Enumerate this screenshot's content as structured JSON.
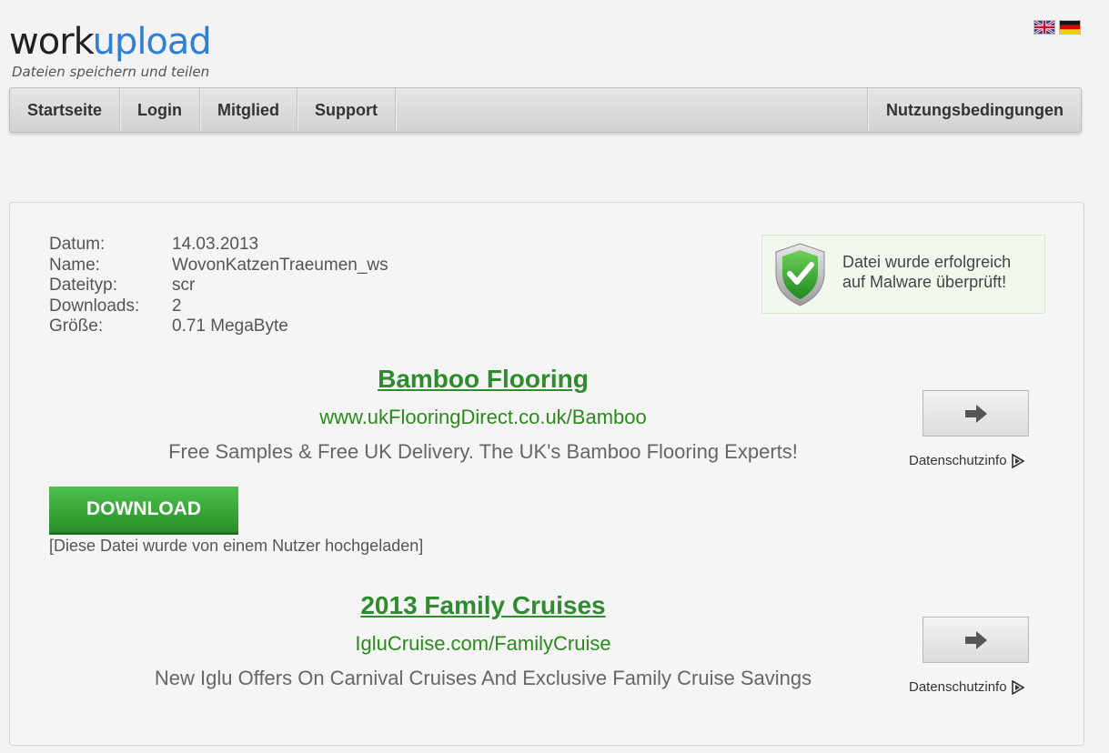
{
  "logo": {
    "part1": "work",
    "part2": "upload",
    "tagline": "Dateien speichern und teilen"
  },
  "flags": [
    {
      "name": "english-flag-icon"
    },
    {
      "name": "german-flag-icon"
    }
  ],
  "nav": {
    "items": [
      {
        "label": "Startseite"
      },
      {
        "label": "Login"
      },
      {
        "label": "Mitglied"
      },
      {
        "label": "Support"
      }
    ],
    "right": {
      "label": "Nutzungsbedingungen"
    }
  },
  "file": {
    "rows": [
      {
        "label": "Datum:",
        "value": "14.03.2013"
      },
      {
        "label": "Name:",
        "value": "WovonKatzenTraeumen_ws"
      },
      {
        "label": "Dateityp:",
        "value": "scr"
      },
      {
        "label": "Downloads:",
        "value": "2"
      },
      {
        "label": "Größe:",
        "value": "0.71 MegaByte"
      }
    ]
  },
  "malware": {
    "line1": "Datei wurde erfolgreich",
    "line2": "auf Malware überprüft!",
    "icon": "shield-check-icon"
  },
  "ads": [
    {
      "title": "Bamboo Flooring",
      "url": "www.ukFlooringDirect.co.uk/Bamboo",
      "desc": "Free Samples & Free UK Delivery. The UK's Bamboo Flooring Experts!",
      "privacy": "Datenschutzinfo"
    },
    {
      "title": "2013 Family Cruises",
      "url": "IgluCruise.com/FamilyCruise",
      "desc": "New Iglu Offers On Carnival Cruises And Exclusive Family Cruise Savings",
      "privacy": "Datenschutzinfo"
    }
  ],
  "download": {
    "label": "DOWNLOAD",
    "note": "[Diese Datei wurde von einem Nutzer hochgeladen]"
  },
  "colors": {
    "accent_blue": "#2f7fd6",
    "ad_green": "#2e8b2e",
    "download_green": "#3aa63a"
  }
}
